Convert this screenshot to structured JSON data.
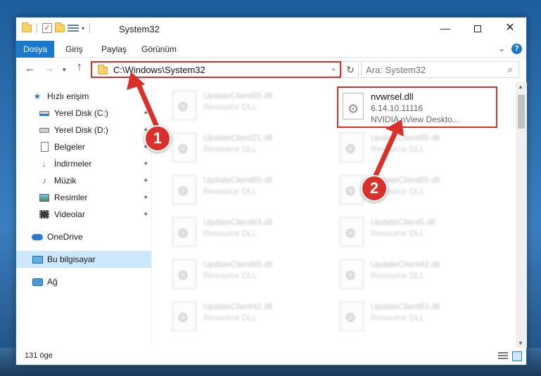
{
  "window": {
    "title": "System32",
    "min_glyph": "—",
    "close_glyph": "✕"
  },
  "ribbon": {
    "tabs": [
      "Dosya",
      "Giriş",
      "Paylaş",
      "Görünüm"
    ],
    "chevron_glyph": "⌄",
    "help_glyph": "?"
  },
  "nav": {
    "back_glyph": "←",
    "forward_glyph": "→",
    "recent_glyph": "▾",
    "up_glyph": "↑"
  },
  "address": {
    "path": "C:\\Windows\\System32",
    "dropdown_glyph": "⌄",
    "refresh_glyph": "↻"
  },
  "search": {
    "placeholder": "Ara: System32",
    "icon_glyph": "⌕"
  },
  "sidebar": {
    "items": [
      {
        "label": "Hızlı erişim",
        "icon": "star-icon"
      },
      {
        "label": "Yerel Disk (C:)",
        "icon": "drive-c-icon",
        "pinned": true
      },
      {
        "label": "Yerel Disk (D:)",
        "icon": "drive-d-icon",
        "pinned": true
      },
      {
        "label": "Belgeler",
        "icon": "documents-icon",
        "pinned": true
      },
      {
        "label": "İndirmeler",
        "icon": "downloads-icon",
        "pinned": true
      },
      {
        "label": "Müzik",
        "icon": "music-icon",
        "pinned": true
      },
      {
        "label": "Resimler",
        "icon": "pictures-icon",
        "pinned": true
      },
      {
        "label": "Videolar",
        "icon": "videos-icon",
        "pinned": true
      },
      {
        "label": "OneDrive",
        "icon": "onedrive-icon"
      },
      {
        "label": "Bu bilgisayar",
        "icon": "this-pc-icon",
        "selected": true
      },
      {
        "label": "Ağ",
        "icon": "network-icon"
      }
    ],
    "pin_glyph": "📌"
  },
  "files": {
    "highlighted": {
      "name": "nvwrsel.dll",
      "version": "6.14.10.11116",
      "description": "NVIDIA nView Deskto..."
    },
    "left_column": [
      {
        "name": "UpdateClient65.dll",
        "type": "Resource DLL"
      },
      {
        "name": "UpdateClient21.dll",
        "type": "Resource DLL"
      },
      {
        "name": "UpdateClient65.dll",
        "type": "Resource DLL"
      },
      {
        "name": "UpdateClient63.dll",
        "type": "Resource DLL"
      },
      {
        "name": "UpdateClient65.dll",
        "type": "Resource DLL"
      },
      {
        "name": "UpdateClient42.dll",
        "type": "Resource DLL"
      }
    ],
    "right_column": [
      {
        "name": "UpdateClient65.dll",
        "type": "Resource DLL"
      },
      {
        "name": "UpdateClient65.dll",
        "type": "Resource DLL"
      },
      {
        "name": "UpdateClient5.dll",
        "type": "Resource DLL"
      },
      {
        "name": "UpdateClient42.dll",
        "type": "Resource DLL"
      },
      {
        "name": "UpdateClient63.dll",
        "type": "Resource DLL"
      }
    ]
  },
  "scrollbar": {
    "up_glyph": "▲",
    "down_glyph": "▼"
  },
  "status": {
    "item_count": "131 öge"
  },
  "annotations": {
    "step1": "1",
    "step2": "2",
    "color": "#d9302a"
  }
}
